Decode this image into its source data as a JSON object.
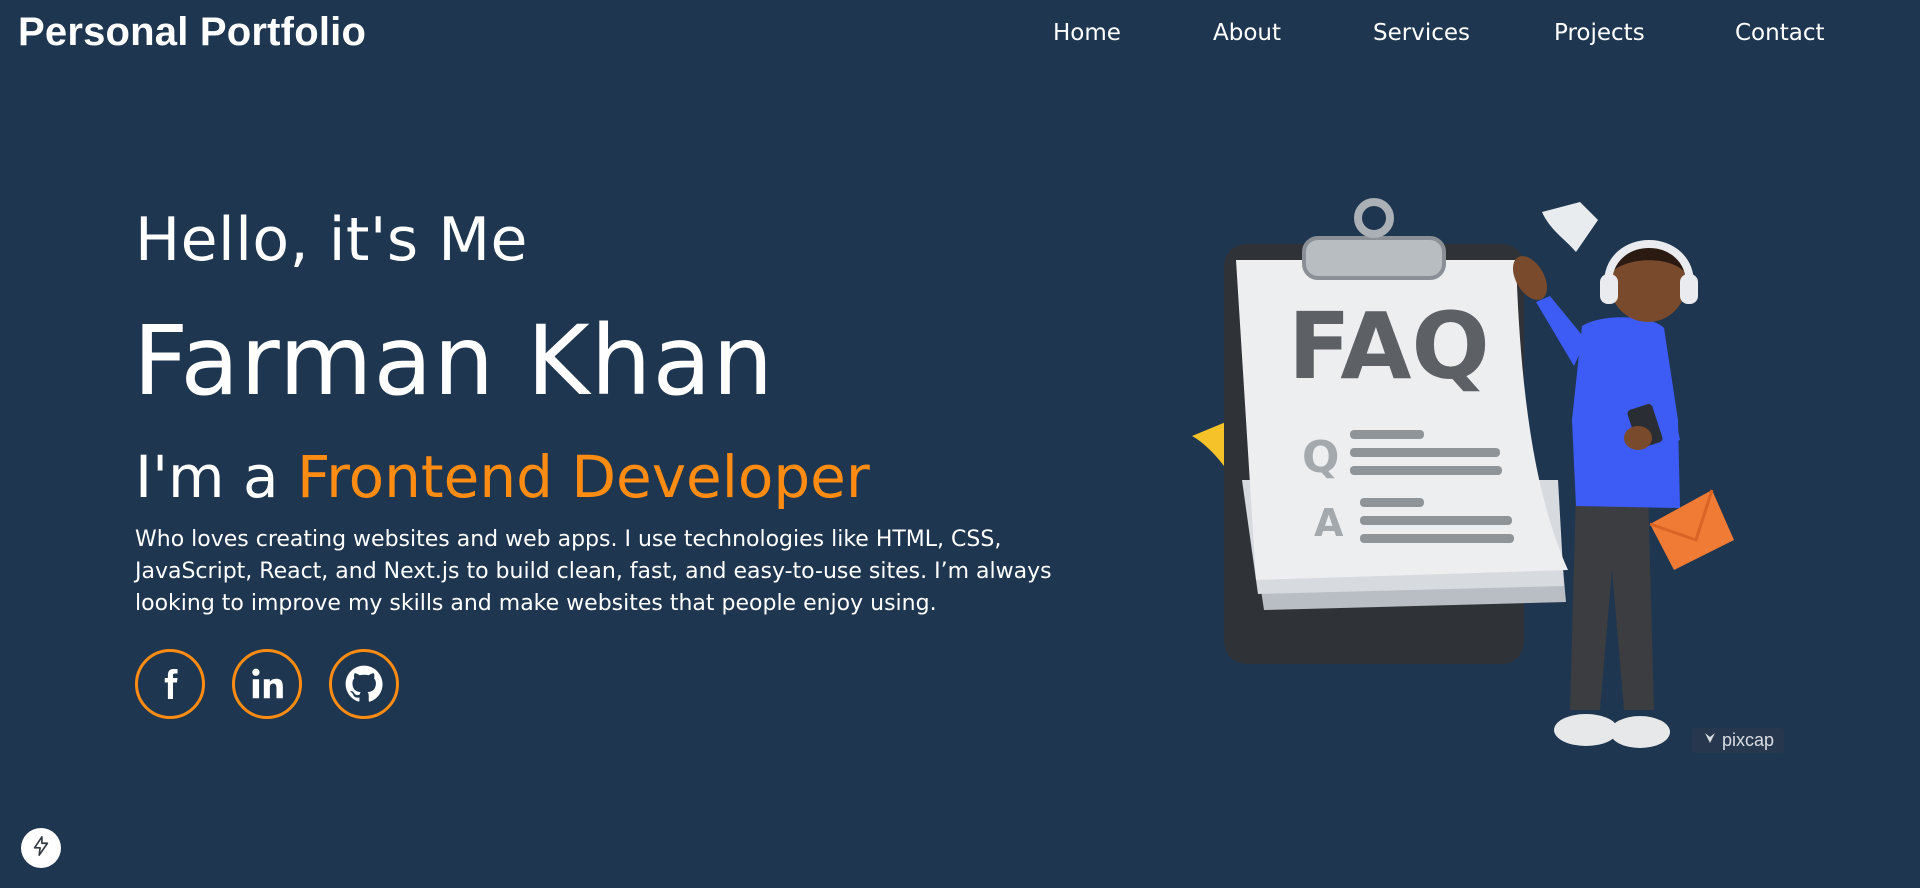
{
  "header": {
    "brand": "Personal Portfolio",
    "nav": [
      "Home",
      "About",
      "Services",
      "Projects",
      "Contact"
    ]
  },
  "hero": {
    "greeting": "Hello, it's Me",
    "name": "Farman Khan",
    "role_prefix": "I'm a ",
    "role_highlight": "Frontend Developer",
    "bio": "Who loves creating websites and web apps. I use technologies like HTML, CSS, JavaScript, React, and Next.js to build clean, fast, and easy-to-use sites. I’m always looking to improve my skills and make websites that people enjoy using.",
    "socials": [
      "facebook-icon",
      "linkedin-icon",
      "github-icon"
    ]
  },
  "illustration": {
    "board_text": "FAQ",
    "q_letter": "Q",
    "a_letter": "A",
    "watermark": "pixcap"
  },
  "colors": {
    "background": "#1f3650",
    "accent": "#ff8c12",
    "text": "#ffffff"
  }
}
